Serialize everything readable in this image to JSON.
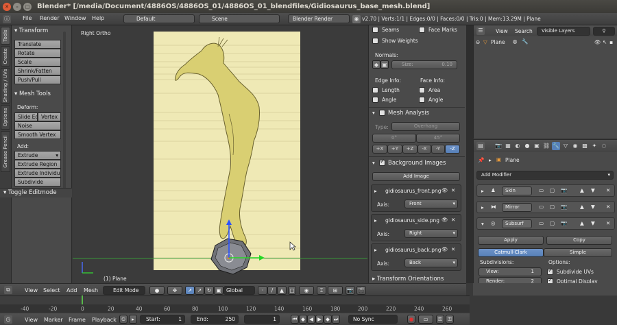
{
  "window": {
    "title": "Blender* [/media/Document/4886OS/4886OS_01/4886OS_01_blendfiles/Gidiosaurus_base_mesh.blend]"
  },
  "menubar": {
    "items": [
      "File",
      "Render",
      "Window",
      "Help"
    ],
    "screen_layout": "Default",
    "scene": "Scene",
    "render_engine": "Blender Render",
    "stats": "v2.70 | Verts:1/1 | Edges:0/0 | Faces:0/0 | Tris:0 | Mem:13.29M | Plane"
  },
  "toolshelf": {
    "tabs": [
      "Tools",
      "Create",
      "Shading / UVs",
      "Options",
      "Grease Pencil"
    ],
    "transform_header": "Transform",
    "transform_buttons": [
      "Translate",
      "Rotate",
      "Scale",
      "Shrink/Fatten",
      "Push/Pull"
    ],
    "mesh_tools_header": "Mesh Tools",
    "deform_label": "Deform:",
    "slide_edge": "Slide Ed",
    "vertex": "Vertex",
    "noise": "Noise",
    "smooth_vertex": "Smooth Vertex",
    "add_label": "Add:",
    "add_buttons": [
      "Extrude",
      "Extrude Region",
      "Extrude Individual",
      "Subdivide"
    ],
    "toggle_editmode": "Toggle Editmode"
  },
  "viewport": {
    "view_label": "Right Ortho",
    "object_label": "(1) Plane"
  },
  "npanel": {
    "seams": "Seams",
    "face_marks": "Face Marks",
    "show_weights": "Show Weights",
    "normals_label": "Normals:",
    "size_label": "Size:",
    "size_value": "0.10",
    "edge_info_label": "Edge Info:",
    "face_info_label": "Face Info:",
    "length": "Length",
    "area": "Area",
    "angle_edge": "Angle",
    "angle_face": "Angle",
    "mesh_analysis_header": "Mesh Analysis",
    "type_label": "Type:",
    "type_value": "Overhang",
    "analysis_min": "0°",
    "analysis_max": "45°",
    "axis_buttons": [
      "+X",
      "+Y",
      "+Z",
      "-X",
      "-Y",
      "-Z"
    ],
    "background_images_header": "Background Images",
    "add_image": "Add Image",
    "images": [
      {
        "name": "gidiosaurus_front.png",
        "axis_label": "Axis:",
        "axis": "Front"
      },
      {
        "name": "gidiosaurus_side.png",
        "axis_label": "Axis:",
        "axis": "Right"
      },
      {
        "name": "gidiosaurus_back.png",
        "axis_label": "Axis:",
        "axis": "Back"
      }
    ],
    "transform_orientations": "Transform Orientations"
  },
  "outliner": {
    "view": "View",
    "search": "Search",
    "filter": "Visible Layers",
    "object": "Plane"
  },
  "properties": {
    "object_name": "Plane",
    "add_modifier": "Add Modifier",
    "modifiers": [
      "Skin",
      "Mirror",
      "Subsurf"
    ],
    "apply": "Apply",
    "copy": "Copy",
    "catmull_clark": "Catmull-Clark",
    "simple": "Simple",
    "subdivisions_label": "Subdivisions:",
    "view_label": "View:",
    "view_value": "1",
    "render_label": "Render:",
    "render_value": "2",
    "options_label": "Options:",
    "subdivide_uvs": "Subdivide UVs",
    "optimal_display": "Optimal Display"
  },
  "viewport_header": {
    "menus": [
      "View",
      "Select",
      "Add",
      "Mesh"
    ],
    "mode": "Edit Mode",
    "orientation": "Global"
  },
  "timeline": {
    "ticks": [
      "-40",
      "-20",
      "0",
      "20",
      "40",
      "60",
      "80",
      "100",
      "120",
      "140",
      "160",
      "180",
      "200",
      "220",
      "240",
      "260"
    ],
    "menus": [
      "View",
      "Marker",
      "Frame",
      "Playback"
    ],
    "start_label": "Start:",
    "start_value": "1",
    "end_label": "End:",
    "end_value": "250",
    "current": "1",
    "sync": "No Sync"
  },
  "colors": {
    "accent_blue": "#5680b8",
    "reference_bg": "#efe9b5",
    "creature_fill": "#d9cf72"
  }
}
